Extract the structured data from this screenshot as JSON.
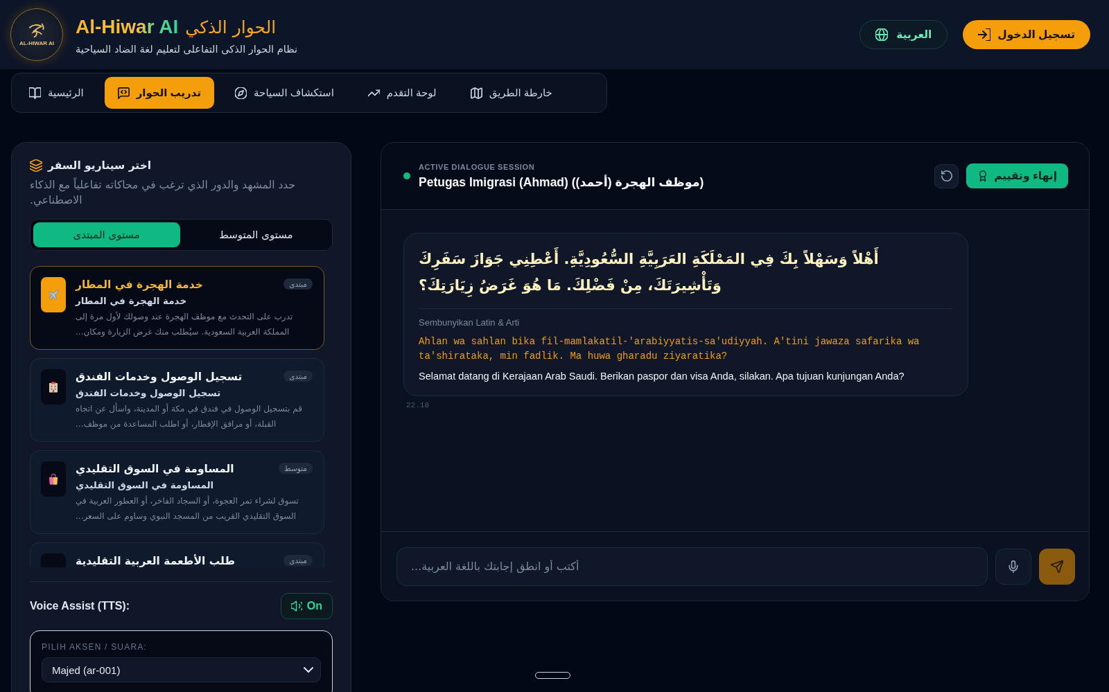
{
  "header": {
    "logo_caption": "AL-HIWAR AI",
    "title_latin": "Al-Hiwar AI",
    "title_arabic": "الحوار الذكي",
    "subtitle": "نظام الحوار الذكى التفاعلى لتعليم لغة الضاد السياحية",
    "language_button": "العربية",
    "login_button": "تسجيل الدخول"
  },
  "navigation": {
    "tabs": [
      {
        "label": "خارطة الطريق",
        "selected": false
      },
      {
        "label": "لوحة التقدم",
        "selected": false
      },
      {
        "label": "استكشاف السياحة",
        "selected": false
      },
      {
        "label": "تدريب الحوار",
        "selected": true
      },
      {
        "label": "الرئيسية",
        "selected": false
      }
    ]
  },
  "scenario_panel": {
    "title": "اختر سيناريو السفر",
    "description": "حدد المشهد والدور الذي ترغب في محاكاته تفاعلياً مع الذكاء الاصطناعي.",
    "levels": [
      {
        "label": "مستوى المتوسط",
        "selected": false
      },
      {
        "label": "مستوى المبتدى",
        "selected": true
      }
    ],
    "scenarios": [
      {
        "title": "خدمة الهجرة في المطار",
        "subtitle": "خدمة الهجرة في المطار",
        "description": "تدرب على التحدث مع موظف الهجرة عند وصولك لأول مرة إلى المملكة العربية السعودية. سيُطلب منك غرض الزيارة ومكان...",
        "level": "مبتدى",
        "selected": true
      },
      {
        "title": "تسجيل الوصول وخدمات الفندق",
        "subtitle": "تسجيل الوصول وخدمات الفندق",
        "description": "قم بتسجيل الوصول في فندق في مكة أو المدينة، واسأل عن اتجاه القبلة، أو مرافق الإفطار، أو اطلب المساعدة من موظف...",
        "level": "مبتدى",
        "selected": false
      },
      {
        "title": "المساومة في السوق التقليدي",
        "subtitle": "المساومة في السوق التقليدي",
        "description": "تسوق لشراء تمر العجوة، أو السجاد الفاخر، أو العطور العربية في السوق التقليدي القريب من المسجد النبوي وساوم على السعر...",
        "level": "متوسط",
        "selected": false
      },
      {
        "title": "طلب الأطعمة العربية التقليدية",
        "level": "مبتدى",
        "selected": false
      }
    ],
    "voice_assist": {
      "label": "Voice Assist (TTS):",
      "toggle_label": "On",
      "on": true
    },
    "voice_select": {
      "label": "PILIH AKSEN / SUARA:",
      "value": "Majed (ar-001)"
    }
  },
  "dialogue": {
    "status_label": "ACTIVE DIALOGUE SESSION",
    "active": true,
    "title": "Petugas Imigrasi (Ahmad) (موظف الهجرة (أحمد))",
    "finish_button": "إنهاء وتقييم",
    "messages": [
      {
        "arabic": "أَهْلاً وَسَهْلاً بِكَ فِي المَمْلَكَةِ العَرَبِيَّةِ السُّعُودِيَّةِ. أَعْطِنِي جَوَازَ سَفَرِكَ وَتَأْشِيرَتَكَ، مِنْ فَضْلِكَ. مَا هُوَ غَرَضُ زِيَارَتِكَ؟",
        "toggle": "Sembunyikan Latin & Arti",
        "transliteration": "Ahlan wa sahlan bika fil-mamlakatil-'arabiyyatis-sa'udiyyah. A'tini jawaza safarika wa ta'shirataka, min fadlik. Ma huwa gharadu ziyaratika?",
        "translation": "Selamat datang di Kerajaan Arab Saudi. Berikan paspor dan visa Anda, silakan. Apa tujuan kunjungan Anda?",
        "time": "22.18"
      }
    ],
    "input": {
      "placeholder": "أكتب أو انطق إجابتك باللغة العربية..."
    },
    "send_button": {
      "disabled": true
    }
  }
}
